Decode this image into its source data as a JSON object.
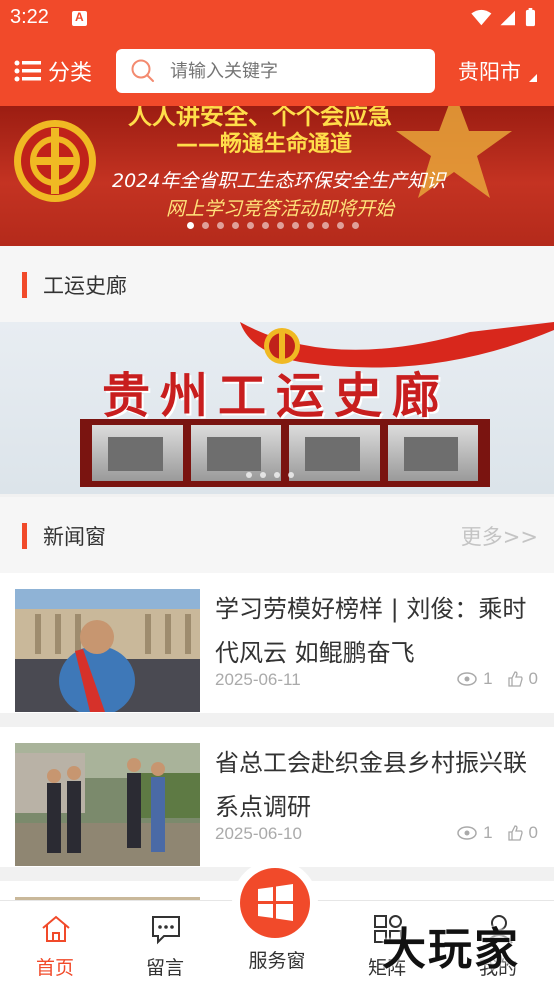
{
  "status_bar": {
    "time": "3:22"
  },
  "header": {
    "menu_label": "分类",
    "search_placeholder": "请输入关键字",
    "city": "贵阳市"
  },
  "banner": {
    "line1": "人人讲安全、个个会应急",
    "line2": "——畅通生命通道",
    "line3": "2024年全省职工生态环保安全生产知识",
    "line4": "网上学习竞答活动即将开始",
    "dot_count": 12,
    "active_dot": 0
  },
  "history_section": {
    "title": "工运史廊",
    "banner_title": "贵州工运史廊"
  },
  "news_section": {
    "title": "新闻窗",
    "more_label": "更多>>",
    "items": [
      {
        "title": "学习劳模好榜样 | 刘俊：乘时代风云 如鲲鹏奋飞",
        "date": "2025-06-11",
        "views": "1",
        "likes": "0"
      },
      {
        "title": "省总工会赴织金县乡村振兴联系点调研",
        "date": "2025-06-10",
        "views": "1",
        "likes": "0"
      }
    ]
  },
  "tabbar": {
    "home": "首页",
    "message": "留言",
    "service": "服务窗",
    "matrix": "矩阵",
    "mine": "我的"
  },
  "watermark": "大玩家",
  "colors": {
    "accent": "#f14a2a"
  }
}
